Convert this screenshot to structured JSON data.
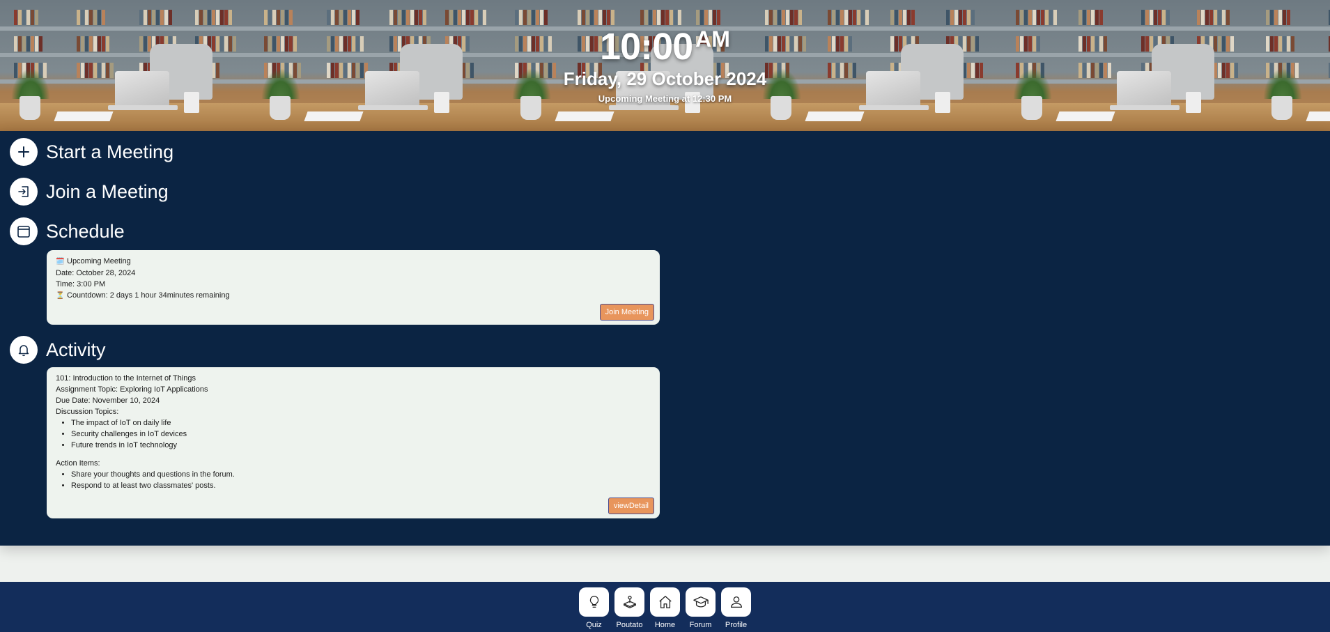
{
  "hero": {
    "time": "10:00",
    "ampm": "AM",
    "date": "Friday, 29 October 2024",
    "next_meeting": "Upcoming Meeting at 12:30 PM"
  },
  "actions": [
    {
      "label": "Start a Meeting",
      "icon": "plus-icon"
    },
    {
      "label": "Join a Meeting",
      "icon": "sign-in-icon"
    },
    {
      "label": "Schedule",
      "icon": "calendar-icon"
    },
    {
      "label": "Activity",
      "icon": "bell-icon"
    }
  ],
  "schedule_card": {
    "heading": "Upcoming Meeting",
    "heading_icon": "🗓️",
    "date": "Date: October 28, 2024",
    "time": "Time: 3:00 PM",
    "countdown_icon": "⏳",
    "countdown": "Countdown: 2 days 1 hour 34minutes remaining",
    "button": "Join Meeting"
  },
  "activity_card": {
    "course": "101: Introduction to the Internet of Things",
    "topic": "Assignment Topic: Exploring IoT Applications",
    "due": "Due Date: November 10, 2024",
    "discussion_heading": "Discussion Topics:",
    "discussion": [
      "The impact of IoT on daily life",
      "Security challenges in IoT devices",
      "Future trends in IoT technology"
    ],
    "action_heading": "Action Items:",
    "action_items": [
      "Share your thoughts and questions in the forum.",
      "Respond to at least two classmates' posts."
    ],
    "button": "viewDetail"
  },
  "bottom_nav": [
    {
      "label": "Quiz",
      "icon": "lightbulb-icon"
    },
    {
      "label": "Poutato",
      "icon": "joystick-icon"
    },
    {
      "label": "Home",
      "icon": "home-icon"
    },
    {
      "label": "Forum",
      "icon": "graduation-cap-icon"
    },
    {
      "label": "Profile",
      "icon": "user-icon"
    }
  ],
  "colors": {
    "navy": "#0b2443",
    "nav_bar": "#132d5b",
    "card_bg": "#eef3ee",
    "button": "#e8955c",
    "page_bg": "#eef1ee"
  }
}
